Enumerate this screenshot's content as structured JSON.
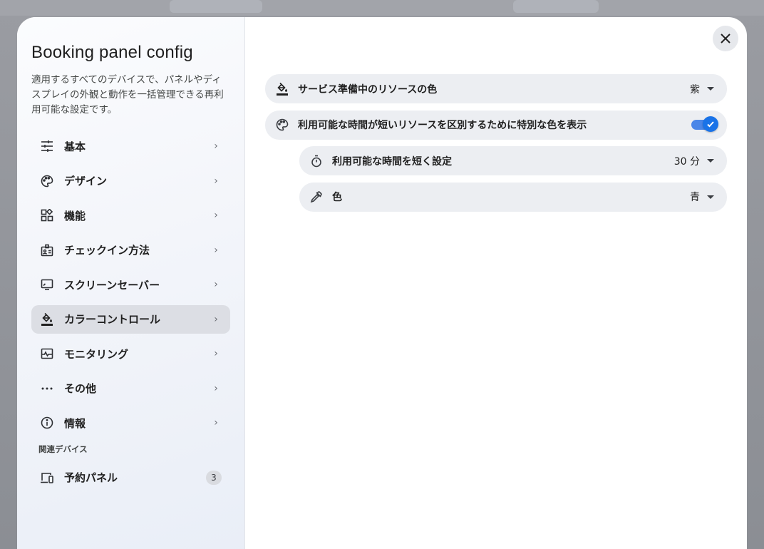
{
  "dialog": {
    "title": "Booking panel config",
    "description": "適用するすべてのデバイスで、パネルやディスプレイの外観と動作を一括管理できる再利用可能な設定です。",
    "close_icon": "close-icon"
  },
  "sidebar": {
    "items": [
      {
        "label": "基本",
        "icon": "tune-icon"
      },
      {
        "label": "デザイン",
        "icon": "palette-icon"
      },
      {
        "label": "機能",
        "icon": "widgets-icon"
      },
      {
        "label": "チェックイン方法",
        "icon": "badge-icon"
      },
      {
        "label": "スクリーンセーバー",
        "icon": "monitor-icon"
      },
      {
        "label": "カラーコントロール",
        "icon": "format-color-fill-icon",
        "active": true
      },
      {
        "label": "モニタリング",
        "icon": "monitoring-icon"
      },
      {
        "label": "その他",
        "icon": "more-horiz-icon"
      },
      {
        "label": "情報",
        "icon": "info-icon"
      }
    ],
    "related_section_label": "関連デバイス",
    "related": {
      "label": "予約パネル",
      "icon": "devices-icon",
      "count": "3"
    }
  },
  "settings": {
    "service_color": {
      "label": "サービス準備中のリソースの色",
      "value": "紫",
      "icon": "format-color-fill-icon"
    },
    "short_availability_toggle": {
      "label": "利用可能な時間が短いリソースを区別するために特別な色を表示",
      "enabled": true,
      "icon": "palette-icon"
    },
    "short_time": {
      "label": "利用可能な時間を短く設定",
      "value": "30 分",
      "icon": "timer-icon"
    },
    "color": {
      "label": "色",
      "value": "青",
      "icon": "colorize-icon"
    }
  },
  "colors": {
    "accent": "#1a73e8",
    "active_nav_bg": "#dcdee4",
    "row_bg": "#eceef2"
  }
}
